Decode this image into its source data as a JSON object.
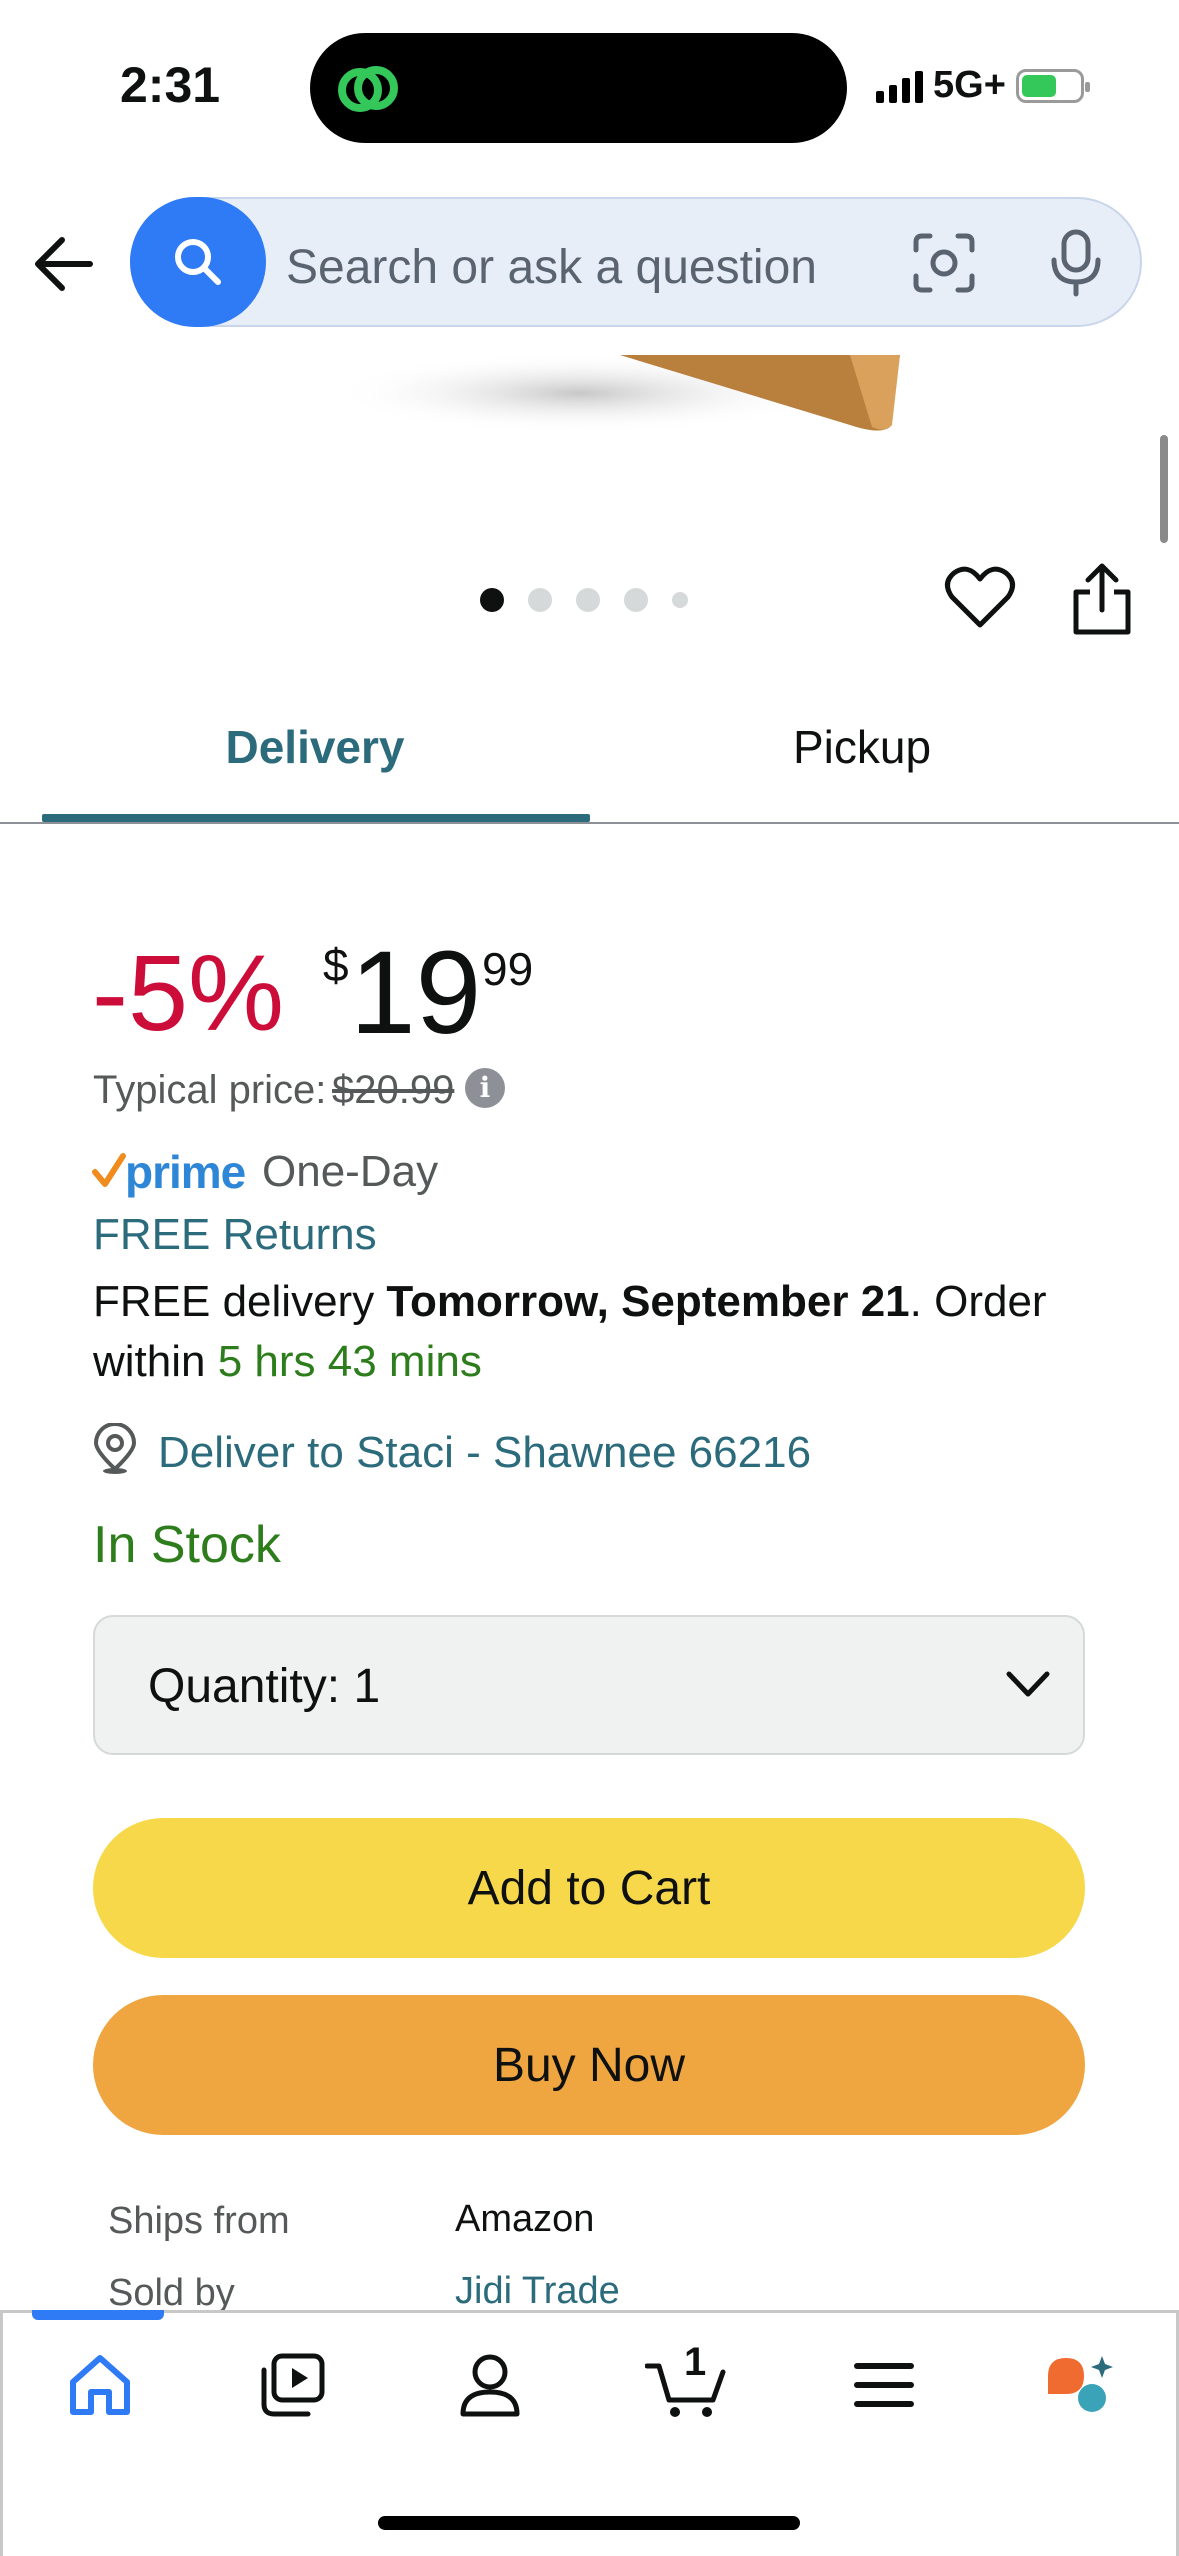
{
  "status_bar": {
    "time": "2:31",
    "network": "5G+"
  },
  "search": {
    "placeholder": "Search or ask a question"
  },
  "carousel": {
    "dot_count": 5,
    "active_index": 0
  },
  "tabs": [
    {
      "label": "Delivery",
      "selected": true
    },
    {
      "label": "Pickup",
      "selected": false
    }
  ],
  "price": {
    "discount": "-5%",
    "currency": "$",
    "whole": "19",
    "fraction": "99",
    "typical_label": "Typical price:",
    "typical_value": "$20.99"
  },
  "prime": {
    "word": "prime",
    "badge": "One-Day"
  },
  "delivery": {
    "free_returns": "FREE Returns",
    "prefix": "FREE delivery ",
    "date": "Tomorrow, September 21",
    "order_text": ". Order within ",
    "countdown": "5 hrs 43 mins",
    "deliver_to": "Deliver to Staci - Shawnee 66216",
    "stock": "In Stock"
  },
  "quantity": {
    "label": "Quantity:",
    "value": "1"
  },
  "buttons": {
    "add_to_cart": "Add to Cart",
    "buy_now": "Buy Now"
  },
  "seller": {
    "ships_from_label": "Ships from",
    "ships_from_value": "Amazon",
    "sold_by_label": "Sold by",
    "sold_by_value": "Jidi Trade"
  },
  "bottom_nav": {
    "cart_count": "1"
  },
  "colors": {
    "accent_blue": "#2f7bf5",
    "tab_teal": "#2c6b7c",
    "discount_red": "#cc0c39",
    "stock_green": "#2d7d1c",
    "add_to_cart": "#f7d84a",
    "buy_now": "#efa540"
  }
}
